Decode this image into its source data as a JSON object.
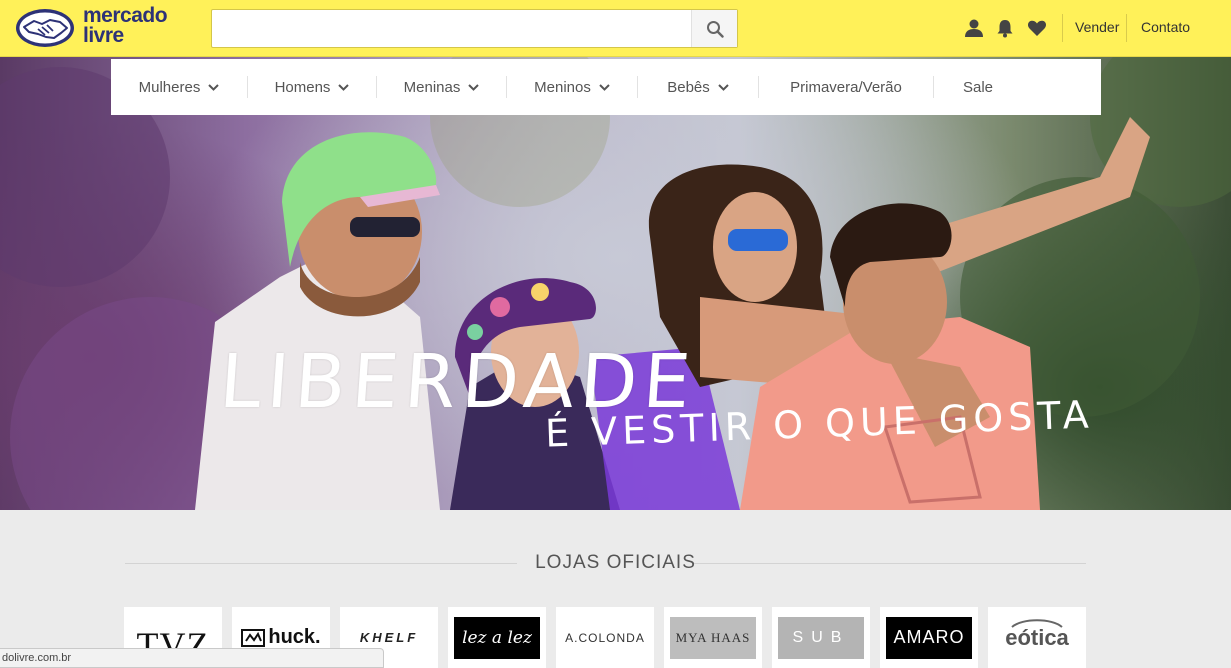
{
  "header": {
    "logo_line1": "mercado",
    "logo_line2": "livre",
    "search_placeholder": "",
    "links": [
      "Vender",
      "Contato"
    ]
  },
  "nav": {
    "items": [
      {
        "label": "Mulheres",
        "dropdown": true
      },
      {
        "label": "Homens",
        "dropdown": true
      },
      {
        "label": "Meninas",
        "dropdown": true
      },
      {
        "label": "Meninos",
        "dropdown": true
      },
      {
        "label": "Bebês",
        "dropdown": true
      },
      {
        "label": "Primavera/Verão",
        "dropdown": false
      },
      {
        "label": "Sale",
        "dropdown": false
      }
    ]
  },
  "hero": {
    "title": "LIBERDADE",
    "subtitle": "É VESTIR O QUE GOSTA"
  },
  "lojas": {
    "title": "LOJAS OFICIAIS",
    "brands": [
      "TVZ",
      "huck.",
      "KHELF",
      "lez a lez",
      "A.COLONDA",
      "MYA HAAS",
      "SUB",
      "AMARO",
      "eótica"
    ]
  },
  "statusbar": {
    "text": "dolivre.com.br"
  },
  "colors": {
    "header_bg": "#fff159",
    "brand_blue": "#2d3277"
  }
}
